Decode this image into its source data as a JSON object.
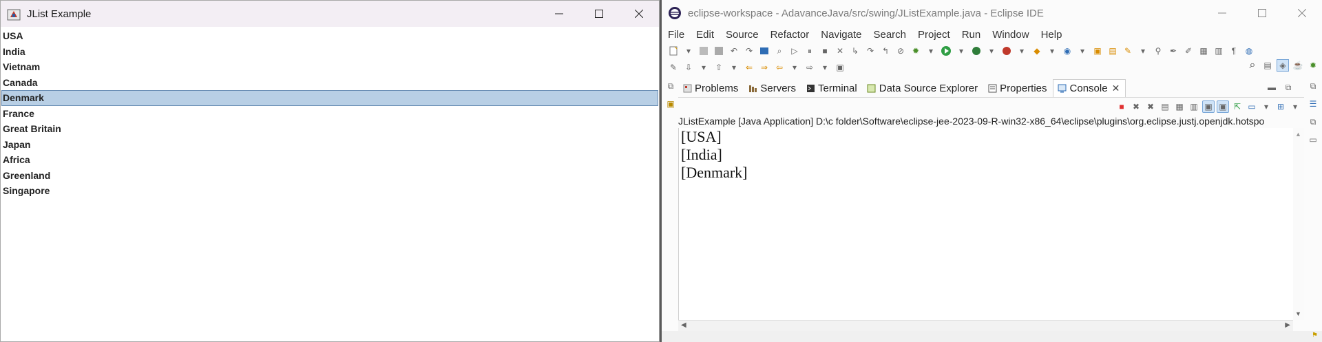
{
  "jlist_window": {
    "title": "JList Example",
    "items": [
      "USA",
      "India",
      "Vietnam",
      "Canada",
      "Denmark",
      "France",
      "Great Britain",
      "Japan",
      "Africa",
      "Greenland",
      "Singapore"
    ],
    "selected": "Denmark"
  },
  "eclipse": {
    "title": "eclipse-workspace - AdavanceJava/src/swing/JListExample.java - Eclipse IDE",
    "menu": [
      "File",
      "Edit",
      "Source",
      "Refactor",
      "Navigate",
      "Search",
      "Project",
      "Run",
      "Window",
      "Help"
    ],
    "view_tabs": [
      {
        "label": "Problems",
        "icon": "problems-icon"
      },
      {
        "label": "Servers",
        "icon": "servers-icon"
      },
      {
        "label": "Terminal",
        "icon": "terminal-icon"
      },
      {
        "label": "Data Source Explorer",
        "icon": "data-source-icon"
      },
      {
        "label": "Properties",
        "icon": "properties-icon"
      },
      {
        "label": "Console",
        "icon": "console-icon",
        "active": true
      }
    ],
    "console_description": "JListExample [Java Application] D:\\c folder\\Software\\eclipse-jee-2023-09-R-win32-x86_64\\eclipse\\plugins\\org.eclipse.justj.openjdk.hotspo",
    "console_output": [
      "[USA]",
      "[India]",
      "[Denmark]"
    ]
  },
  "colors": {
    "selection": "#b8cfe5",
    "selection_border": "#6b8fb5",
    "divider": "#5a5a5a"
  }
}
